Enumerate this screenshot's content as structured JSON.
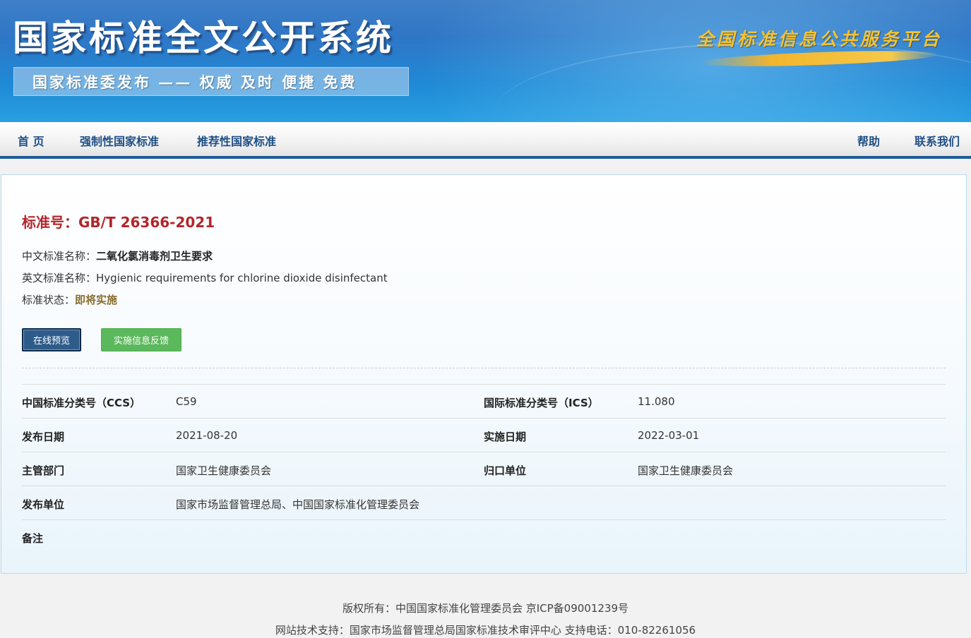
{
  "header": {
    "site_title": "国家标准全文公开系统",
    "subtitle": "国家标准委发布 —— 权威 及时 便捷 免费",
    "platform": "全国标准信息公共服务平台"
  },
  "nav": {
    "home": "首 页",
    "mandatory": "强制性国家标准",
    "recommended": "推荐性国家标准",
    "help": "帮助",
    "contact": "联系我们"
  },
  "standard": {
    "number_label": "标准号：",
    "number": "GB/T 26366-2021",
    "cn_name_label": "中文标准名称：",
    "cn_name": "二氧化氯消毒剂卫生要求",
    "en_name_label": "英文标准名称：",
    "en_name": "Hygienic requirements for chlorine dioxide disinfectant",
    "status_label": "标准状态：",
    "status": "即将实施"
  },
  "buttons": {
    "preview": "在线预览",
    "feedback": "实施信息反馈"
  },
  "info": {
    "ccs_label": "中国标准分类号（CCS）",
    "ccs": "C59",
    "ics_label": "国际标准分类号（ICS）",
    "ics": "11.080",
    "publish_date_label": "发布日期",
    "publish_date": "2021-08-20",
    "implement_date_label": "实施日期",
    "implement_date": "2022-03-01",
    "authority_label": "主管部门",
    "authority": "国家卫生健康委员会",
    "centralized_label": "归口单位",
    "centralized": "国家卫生健康委员会",
    "publisher_label": "发布单位",
    "publisher": "国家市场监督管理总局、中国国家标准化管理委员会",
    "remarks_label": "备注",
    "remarks": ""
  },
  "footer": {
    "copyright": "版权所有：中国国家标准化管理委员会 京ICP备09001239号",
    "support": "网站技术支持：国家市场监督管理总局国家标准技术审评中心 支持电话：010-82261056"
  },
  "colors": {
    "banner_blue": "#2f76c6",
    "nav_text": "#1f4f86",
    "std_red": "#b3262a",
    "status_brown": "#8a6d2d",
    "preview_btn": "#2e5c8a",
    "feedback_btn": "#5cb85c"
  }
}
